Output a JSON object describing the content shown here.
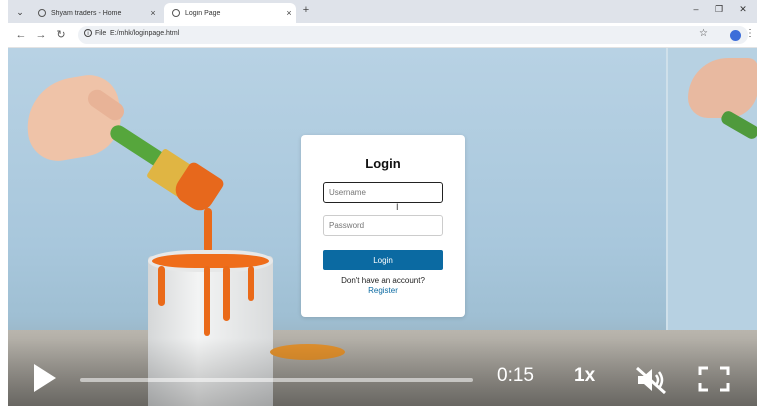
{
  "browser": {
    "tabs": [
      {
        "title": "Shyam traders - Home",
        "close": "×"
      },
      {
        "title": "Login Page",
        "close": "×"
      }
    ],
    "new_tab": "+",
    "menu_glyph": "⌄",
    "window_controls": {
      "minimize": "–",
      "restore": "❐",
      "close": "✕"
    },
    "nav": {
      "back": "←",
      "forward": "→",
      "reload": "↻"
    },
    "site_info_label": "File",
    "url": "E:/mhk/loginpage.html",
    "bookmark_glyph": "☆",
    "menu_dots": "⋮"
  },
  "login": {
    "title": "Login",
    "username_placeholder": "Username",
    "password_placeholder": "Password",
    "submit_label": "Login",
    "account_prompt": "Don't have an account?",
    "register_link": "Register"
  },
  "player": {
    "time": "0:15",
    "speed": "1x",
    "muted": true,
    "progress": 0.0
  },
  "colors": {
    "accent": "#0b6aa2",
    "paint": "#ef6d1a",
    "brush_handle": "#56a63c"
  }
}
